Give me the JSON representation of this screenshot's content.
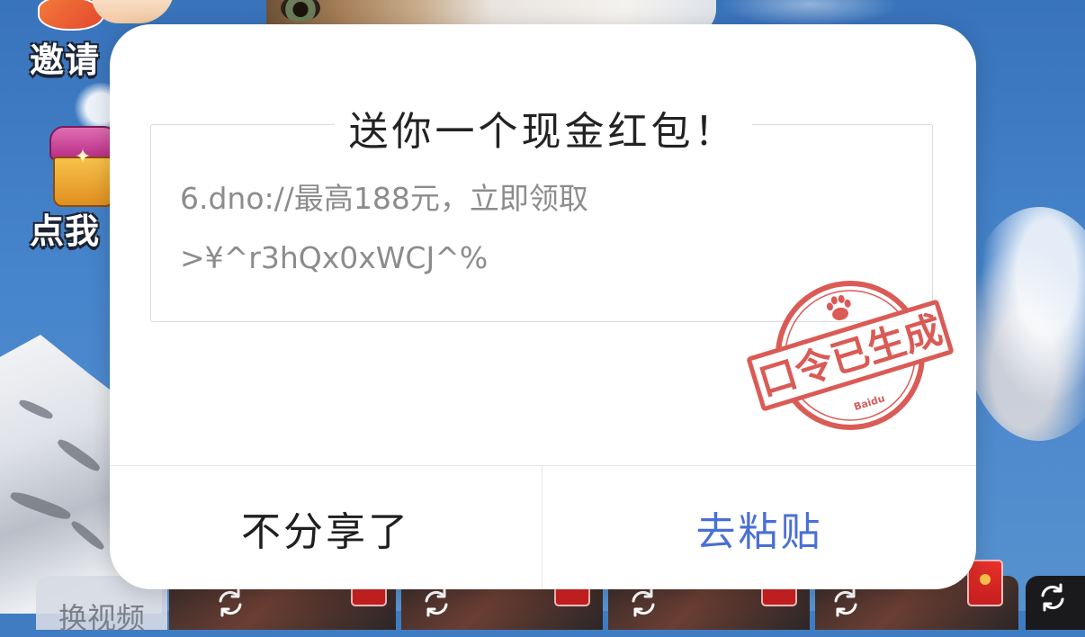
{
  "colors": {
    "accent": "#4a6fd5",
    "stamp_red": "#d6453f",
    "title_text": "#222222",
    "body_text": "#8c8c8c",
    "divider": "#e6e6e6",
    "sky": "#4684cb"
  },
  "background": {
    "invite_label": "邀请",
    "claim_label": "点我",
    "gift_icon": "gift-box-icon",
    "switch_video_label": "换视频",
    "thumbnails": [
      {
        "action_icon": "refresh-icon",
        "badge_icon": "red-envelope-icon"
      },
      {
        "action_icon": "refresh-icon",
        "badge_icon": "red-envelope-icon"
      },
      {
        "action_icon": "refresh-icon",
        "badge_icon": "red-envelope-icon"
      },
      {
        "action_icon": "refresh-icon",
        "badge_icon": "red-envelope-icon"
      },
      {
        "action_icon": "refresh-icon"
      }
    ]
  },
  "dialog": {
    "title": "送你一个现金红包！",
    "command_lines": [
      "6.dno://最高188元，立即领取",
      ">¥^r3hQx0xWCJ^%"
    ],
    "stamp": {
      "text": "口令已生成",
      "brand": "Baidu",
      "icon": "paw-icon"
    },
    "cancel_label": "不分享了",
    "paste_label": "去粘贴"
  }
}
